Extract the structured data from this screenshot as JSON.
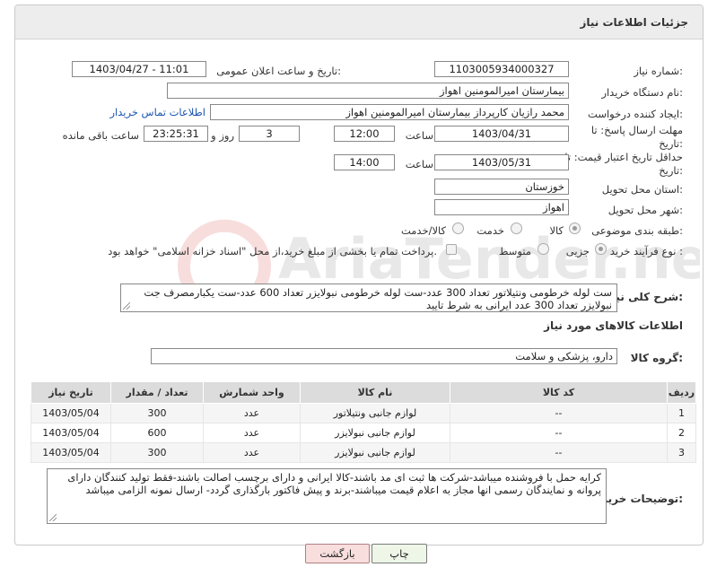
{
  "header": {
    "title": "جزئیات اطلاعات نیاز"
  },
  "need_number": {
    "label": "شماره نیاز:",
    "value": "1103005934000327"
  },
  "announce": {
    "label": "تاریخ و ساعت اعلان عمومی:",
    "value": "1403/04/27 - 11:01"
  },
  "buyer": {
    "label": "نام دستگاه خریدار:",
    "value": "بیمارستان امیرالمومنین اهواز"
  },
  "creator": {
    "label": "ایجاد کننده درخواست:",
    "value": "محمد رازیان کارپرداز بیمارستان امیرالمومنین اهواز",
    "contact_link": "اطلاعات تماس خریدار"
  },
  "deadline": {
    "label_line1": "مهلت ارسال پاسخ: تا",
    "label_line2": "تاریخ:",
    "date": "1403/04/31",
    "time_label": "ساعت",
    "time": "12:00",
    "days": "3",
    "days_label": "روز و",
    "remaining": "23:25:31",
    "remaining_label": "ساعت باقی مانده"
  },
  "validity": {
    "label_line1": "حداقل تاریخ اعتبار قیمت: تا",
    "label_line2": "تاریخ:",
    "date": "1403/05/31",
    "time_label": "ساعت",
    "time": "14:00"
  },
  "province": {
    "label": "استان محل تحویل:",
    "value": "خوزستان"
  },
  "city": {
    "label": "شهر محل تحویل:",
    "value": "اهواز"
  },
  "category": {
    "label": "طبقه بندی موضوعی:",
    "options": [
      "کالا",
      "خدمت",
      "کالا/خدمت"
    ],
    "selected": "کالا"
  },
  "process": {
    "label": "نوع فرآیند خرید :",
    "options": [
      "جزیی",
      "متوسط"
    ],
    "selected": "جزیی",
    "note": "پرداخت تمام یا بخشی از مبلغ خرید،از محل \"اسناد خزانه اسلامی\" خواهد بود."
  },
  "description": {
    "label": "شرح کلی نیاز:",
    "text": "ست لوله خرطومی ونتیلاتور تعداد 300 عدد-ست لوله خرطومی نبولایزر تعداد 600 عدد-ست یکبارمصرف جت نبولایزر تعداد 300 عدد ایرانی به شرط تایید"
  },
  "goods_section": {
    "title": "اطلاعات کالاهای مورد نیاز"
  },
  "goods_group": {
    "label": "گروه کالا:",
    "value": "دارو، پزشکی و سلامت"
  },
  "table": {
    "columns": [
      "ردیف",
      "کد کالا",
      "نام کالا",
      "واحد شمارش",
      "تعداد / مقدار",
      "تاریخ نیاز"
    ],
    "rows": [
      [
        "1",
        "--",
        "لوازم جانبی ونتیلاتور",
        "عدد",
        "300",
        "1403/05/04"
      ],
      [
        "2",
        "--",
        "لوازم جانبی نبولایزر",
        "عدد",
        "600",
        "1403/05/04"
      ],
      [
        "3",
        "--",
        "لوازم جانبی نبولایزر",
        "عدد",
        "300",
        "1403/05/04"
      ]
    ]
  },
  "buyer_notes": {
    "label": "توضیحات خریدار:",
    "text": "کرایه حمل با فروشنده میباشد-شرکت ها ثبت ای مد باشند-کالا ایرانی و دارای برچسب اصالت باشند-فقط تولید کنندگان دارای پروانه و نمایندگان رسمی انها مجاز به اعلام قیمت میباشند-برند و پیش فاکتور بارگذاری گردد- ارسال نمونه الزامی میباشد"
  },
  "buttons": {
    "print": "چاپ",
    "back": "بازگشت"
  },
  "watermark": {
    "text": "AriaTender.neT"
  }
}
